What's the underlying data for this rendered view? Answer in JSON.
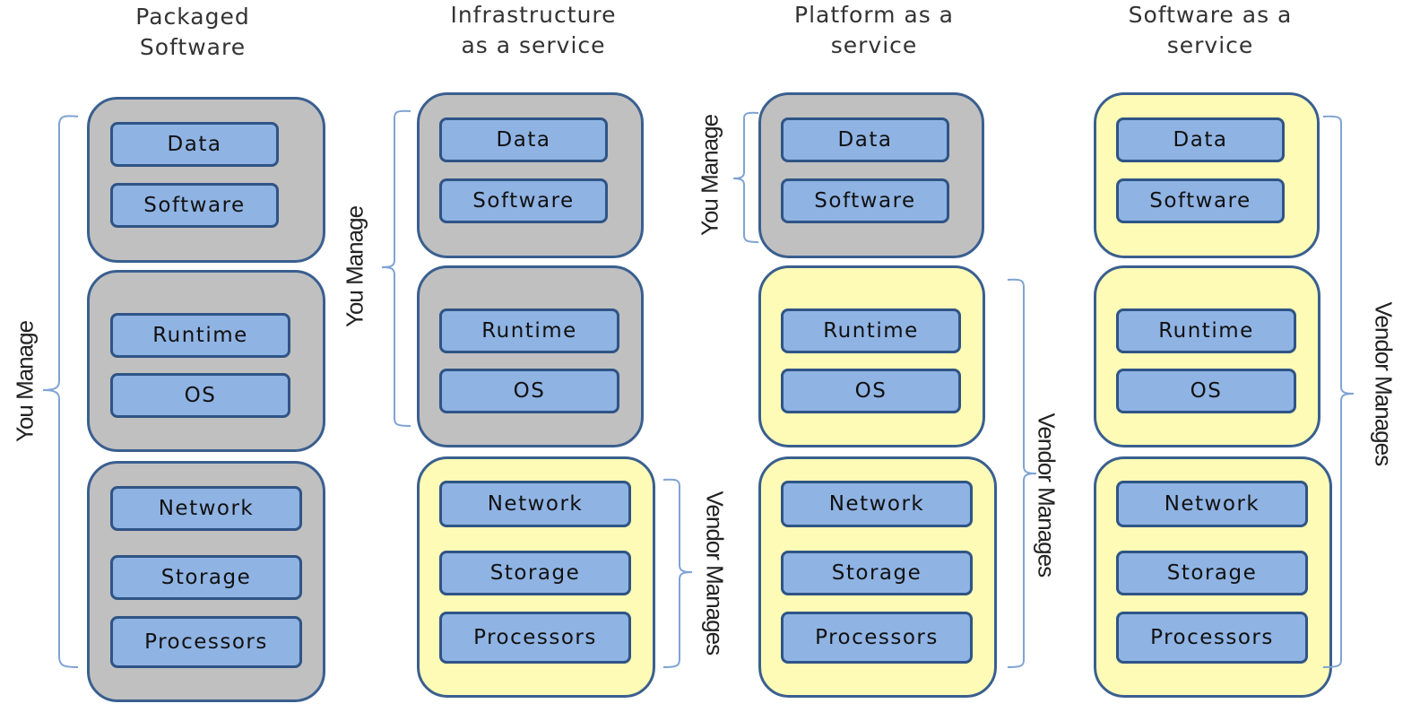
{
  "colors": {
    "you_manage_fill": "#c0c0c0",
    "vendor_manages_fill": "#fdfbb5",
    "layer_fill": "#8fb3e3",
    "border": "#3a5f8f",
    "bracket": "#7fa3d4"
  },
  "columns": [
    {
      "title": "Packaged\nSoftware",
      "groups": [
        {
          "owner": "you",
          "layers": [
            "Data",
            "Software"
          ]
        },
        {
          "owner": "you",
          "layers": [
            "Runtime",
            "OS"
          ]
        },
        {
          "owner": "you",
          "layers": [
            "Network",
            "Storage",
            "Processors"
          ]
        }
      ],
      "brackets": [
        {
          "label": "You Manage",
          "side": "left"
        }
      ]
    },
    {
      "title": "Infrastructure\nas a service",
      "groups": [
        {
          "owner": "you",
          "layers": [
            "Data",
            "Software"
          ]
        },
        {
          "owner": "you",
          "layers": [
            "Runtime",
            "OS"
          ]
        },
        {
          "owner": "vendor",
          "layers": [
            "Network",
            "Storage",
            "Processors"
          ]
        }
      ],
      "brackets": [
        {
          "label": "You Manage",
          "side": "left"
        },
        {
          "label": "Vendor Manages",
          "side": "right"
        }
      ]
    },
    {
      "title": "Platform as a\nservice",
      "groups": [
        {
          "owner": "you",
          "layers": [
            "Data",
            "Software"
          ]
        },
        {
          "owner": "vendor",
          "layers": [
            "Runtime",
            "OS"
          ]
        },
        {
          "owner": "vendor",
          "layers": [
            "Network",
            "Storage",
            "Processors"
          ]
        }
      ],
      "brackets": [
        {
          "label": "You Manage",
          "side": "left"
        },
        {
          "label": "Vendor Manages",
          "side": "right"
        }
      ]
    },
    {
      "title": "Software as a\nservice",
      "groups": [
        {
          "owner": "vendor",
          "layers": [
            "Data",
            "Software"
          ]
        },
        {
          "owner": "vendor",
          "layers": [
            "Runtime",
            "OS"
          ]
        },
        {
          "owner": "vendor",
          "layers": [
            "Network",
            "Storage",
            "Processors"
          ]
        }
      ],
      "brackets": [
        {
          "label": "Vendor Manages",
          "side": "right"
        }
      ]
    }
  ]
}
